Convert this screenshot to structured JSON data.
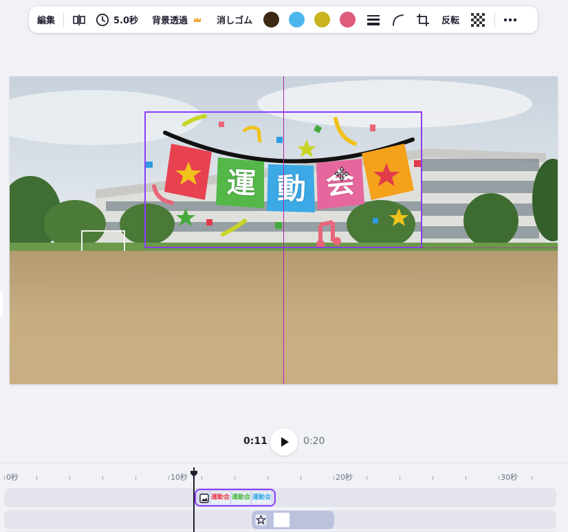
{
  "toolbar": {
    "edit_label": "編集",
    "duration_label": "5.0秒",
    "bg_remove_label": "背景透過",
    "eraser_label": "消しゴム",
    "flip_label": "反転",
    "swatches": [
      "#3d2a12",
      "#4cb7ec",
      "#c9b41f",
      "#e05a7a"
    ]
  },
  "canvas": {
    "sticker_icon": "undokai-banner-sticker",
    "sticker_text": [
      "運",
      "動",
      "会"
    ]
  },
  "playback": {
    "current_time": "0:11",
    "total_time": "0:20"
  },
  "timeline": {
    "ruler_labels": [
      "0秒",
      "10秒",
      "20秒",
      "30秒"
    ],
    "clip_thumbnail_text": "運動会"
  },
  "colors": {
    "accent": "#8b3dff",
    "guide": "#b321b0"
  }
}
